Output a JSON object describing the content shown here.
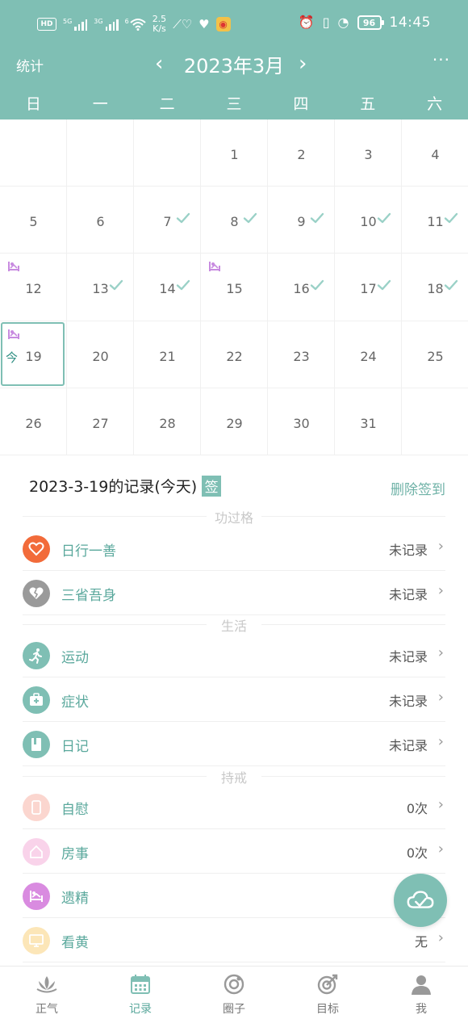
{
  "status_bar": {
    "hd": "HD",
    "sig1": "5G",
    "sig2": "3G",
    "wifi": "6",
    "speed_value": "2.5",
    "speed_unit": "K/s",
    "battery": "96",
    "time": "14:45"
  },
  "nav": {
    "stats_label": "统计",
    "prev": "‹",
    "month": "2023年3月",
    "next": "›",
    "more": "···"
  },
  "weekdays": [
    "日",
    "一",
    "二",
    "三",
    "四",
    "五",
    "六"
  ],
  "calendar": {
    "today_tag": "今",
    "days": [
      {
        "n": ""
      },
      {
        "n": ""
      },
      {
        "n": ""
      },
      {
        "n": "1"
      },
      {
        "n": "2"
      },
      {
        "n": "3"
      },
      {
        "n": "4"
      },
      {
        "n": "5"
      },
      {
        "n": "6"
      },
      {
        "n": "7",
        "checked": true
      },
      {
        "n": "8",
        "checked": true
      },
      {
        "n": "9",
        "checked": true
      },
      {
        "n": "10",
        "checked": true
      },
      {
        "n": "11",
        "checked": true
      },
      {
        "n": "12",
        "mark": true
      },
      {
        "n": "13",
        "checked": true
      },
      {
        "n": "14",
        "checked": true
      },
      {
        "n": "15",
        "mark": true
      },
      {
        "n": "16",
        "checked": true
      },
      {
        "n": "17",
        "checked": true
      },
      {
        "n": "18",
        "checked": true
      },
      {
        "n": "19",
        "mark": true,
        "today": true
      },
      {
        "n": "20"
      },
      {
        "n": "21"
      },
      {
        "n": "22"
      },
      {
        "n": "23"
      },
      {
        "n": "24"
      },
      {
        "n": "25"
      },
      {
        "n": "26"
      },
      {
        "n": "27"
      },
      {
        "n": "28"
      },
      {
        "n": "29"
      },
      {
        "n": "30"
      },
      {
        "n": "31"
      },
      {
        "n": ""
      }
    ]
  },
  "records": {
    "title": "2023-3-19的记录(今天)",
    "sign_badge": "签",
    "delete_sign": "删除签到",
    "sections": [
      {
        "title": "功过格",
        "items": [
          {
            "label": "日行一善",
            "value": "未记录",
            "icon": "heart-icon",
            "color": "#f26b3a"
          },
          {
            "label": "三省吾身",
            "value": "未记录",
            "icon": "broken-heart-icon",
            "color": "#9a9a9a"
          }
        ]
      },
      {
        "title": "生活",
        "items": [
          {
            "label": "运动",
            "value": "未记录",
            "icon": "running-icon",
            "color": "#7fbfb4"
          },
          {
            "label": "症状",
            "value": "未记录",
            "icon": "medical-kit-icon",
            "color": "#7fbfb4"
          },
          {
            "label": "日记",
            "value": "未记录",
            "icon": "notebook-icon",
            "color": "#7fbfb4"
          }
        ]
      },
      {
        "title": "持戒",
        "items": [
          {
            "label": "自慰",
            "value": "0次",
            "icon": "phone-icon",
            "color": "#fbd6cf"
          },
          {
            "label": "房事",
            "value": "0次",
            "icon": "house-icon",
            "color": "#f9d3ea"
          },
          {
            "label": "遗精",
            "value": "",
            "icon": "bed-icon",
            "color": "#d98be0"
          },
          {
            "label": "看黄",
            "value": "无",
            "icon": "monitor-icon",
            "color": "#fce6b8"
          }
        ]
      }
    ]
  },
  "tabs": [
    {
      "label": "正气",
      "icon": "lotus-icon"
    },
    {
      "label": "记录",
      "icon": "calendar-icon",
      "active": true
    },
    {
      "label": "圈子",
      "icon": "circle-icon"
    },
    {
      "label": "目标",
      "icon": "target-icon"
    },
    {
      "label": "我",
      "icon": "user-icon"
    }
  ],
  "colors": {
    "primary": "#7fbfb4",
    "label_green": "#5aa89c",
    "mark_purple": "#c88be0"
  }
}
